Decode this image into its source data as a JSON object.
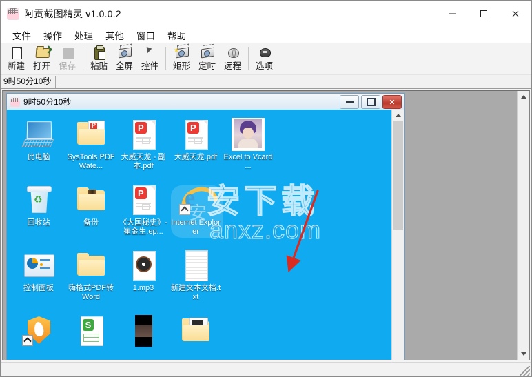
{
  "window": {
    "title": "阿贡截图精灵 v1.0.0.2",
    "icon": "app-pig-icon",
    "controls": {
      "minimize": "minimize-icon",
      "maximize": "maximize-icon",
      "close": "close-icon"
    }
  },
  "menu": {
    "items": [
      {
        "label": "文件"
      },
      {
        "label": "操作"
      },
      {
        "label": "处理"
      },
      {
        "label": "其他"
      },
      {
        "label": "窗口"
      },
      {
        "label": "帮助"
      }
    ]
  },
  "toolbar": {
    "buttons": [
      {
        "label": "新建",
        "icon": "new-page-icon",
        "disabled": false
      },
      {
        "label": "打开",
        "icon": "open-folder-icon",
        "disabled": false
      },
      {
        "label": "保存",
        "icon": "save-icon",
        "disabled": true
      },
      {
        "label": "粘贴",
        "icon": "paste-clipboard-icon",
        "disabled": false
      },
      {
        "label": "全屏",
        "icon": "fullscreen-capture-icon",
        "disabled": false
      },
      {
        "label": "控件",
        "icon": "control-capture-icon",
        "disabled": false
      },
      {
        "label": "矩形",
        "icon": "rectangle-capture-icon",
        "disabled": false
      },
      {
        "label": "定时",
        "icon": "timer-capture-icon",
        "disabled": false
      },
      {
        "label": "远程",
        "icon": "remote-capture-icon",
        "disabled": false
      },
      {
        "label": "选项",
        "icon": "options-icon",
        "disabled": false
      }
    ]
  },
  "timestrip": {
    "tab_label": "9时50分10秒"
  },
  "child_window": {
    "title": "9时50分10秒",
    "icon": "app-pig-icon",
    "controls": {
      "minimize": "minimize-icon",
      "maximize": "maximize-icon",
      "close": "close-icon"
    }
  },
  "desktop": {
    "background_color": "#0faaf0",
    "icons": [
      {
        "label": "此电脑",
        "type": "pc",
        "shortcut": false
      },
      {
        "label": "SysTools PDF Wate...",
        "type": "folder-pdf",
        "shortcut": false
      },
      {
        "label": "大威天龙 - 副本.pdf",
        "type": "pdf",
        "shortcut": false
      },
      {
        "label": "大威天龙.pdf",
        "type": "pdf",
        "shortcut": false
      },
      {
        "label": "Excel to Vcard ...",
        "type": "photo",
        "shortcut": false
      },
      {
        "label": "回收站",
        "type": "recycle-bin",
        "shortcut": false
      },
      {
        "label": "备份",
        "type": "folder-book",
        "shortcut": false
      },
      {
        "label": "《大国秘史》- 崔金生.ep...",
        "type": "pdf",
        "shortcut": false
      },
      {
        "label": "Internet Explorer",
        "type": "ie",
        "shortcut": true
      },
      {
        "label": "",
        "type": "empty",
        "shortcut": false
      },
      {
        "label": "控制面板",
        "type": "control-panel",
        "shortcut": false
      },
      {
        "label": "嗨格式PDF转Word",
        "type": "folder-plain",
        "shortcut": false
      },
      {
        "label": "1.mp3",
        "type": "mp3",
        "shortcut": false
      },
      {
        "label": "新建文本文档.txt",
        "type": "txt",
        "shortcut": false
      },
      {
        "label": "",
        "type": "empty",
        "shortcut": false
      },
      {
        "label": "",
        "type": "shield",
        "shortcut": true
      },
      {
        "label": "",
        "type": "wps",
        "shortcut": false
      },
      {
        "label": "",
        "type": "video",
        "shortcut": false
      },
      {
        "label": "",
        "type": "folder-docs",
        "shortcut": false
      },
      {
        "label": "",
        "type": "empty",
        "shortcut": false
      }
    ]
  },
  "watermark": {
    "chinese": "安下载",
    "latin": "anxz.com",
    "badge_char": "安"
  },
  "annotation": {
    "type": "red-arrow",
    "color": "#d92b20"
  },
  "scrollbars": {
    "up_arrow": "chevron-up-icon",
    "down_arrow": "chevron-down-icon"
  },
  "statusbar": {
    "resize_grip": "resize-grip-icon"
  }
}
